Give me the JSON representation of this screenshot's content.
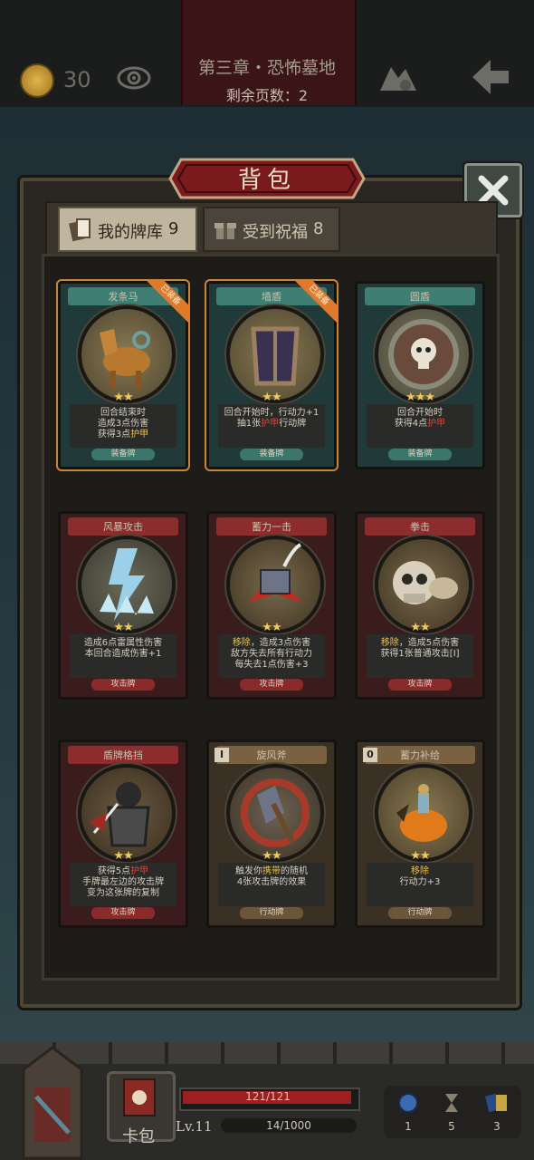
{
  "topbar": {
    "coins": "30",
    "chapter_title": "第三章・恐怖墓地",
    "pages_left": "剩余页数：2"
  },
  "panel": {
    "title": "背包",
    "tabs": [
      {
        "label": "我的牌库",
        "count": "9",
        "active": true
      },
      {
        "label": "受到祝福",
        "count": "8",
        "active": false
      }
    ]
  },
  "cards": [
    {
      "name": "发条马",
      "stars": "★★",
      "desc1": "回合结束时",
      "desc2": "造成3点伤害",
      "desc3_pre": "获得3点",
      "desc3_hl": "护甲",
      "type": "装备牌",
      "equipped": true,
      "badge": "已装备"
    },
    {
      "name": "墙盾",
      "stars": "★★",
      "desc1": "回合开始时，行动力+1",
      "desc2_pre": "抽1张",
      "desc2_hl": "护甲",
      "desc2_post": "行动牌",
      "type": "装备牌",
      "equipped": true,
      "badge": "已装备"
    },
    {
      "name": "圆盾",
      "stars": "★★★",
      "desc1": "回合开始时",
      "desc2_pre": "获得4点",
      "desc2_hl": "护甲",
      "type": "装备牌",
      "equipped": false
    },
    {
      "name": "风暴攻击",
      "stars": "★★",
      "desc1": "造成6点雷属性伤害",
      "desc2": "本回合造成伤害+1",
      "type": "攻击牌"
    },
    {
      "name": "蓄力一击",
      "stars": "★★",
      "desc1_hl": "移除",
      "desc1": "，造成3点伤害",
      "desc2": "敌方失去所有行动力",
      "desc3": "每失去1点伤害+3",
      "type": "攻击牌"
    },
    {
      "name": "拳击",
      "stars": "★★",
      "desc1_hl": "移除",
      "desc1": "，造成5点伤害",
      "desc2": "获得1张普通攻击[I]",
      "type": "攻击牌"
    },
    {
      "name": "盾牌格挡",
      "stars": "★★",
      "desc1_pre": "获得5点",
      "desc1_hl": "护甲",
      "desc2": "手牌最左边的攻击牌",
      "desc3": "变为这张牌的复制",
      "type": "攻击牌"
    },
    {
      "name": "旋风斧",
      "stars": "★★",
      "desc1_pre": "触发你",
      "desc1_hl": "携带",
      "desc1_post": "的随机",
      "desc2": "4张攻击牌的效果",
      "type": "行动牌",
      "corner": "I"
    },
    {
      "name": "蓄力补给",
      "stars": "★★",
      "desc1_hl": "移除",
      "desc2": "行动力+3",
      "type": "行动牌",
      "corner": "0"
    }
  ],
  "bottom": {
    "bag_label": "卡包",
    "hp": "121/121",
    "hp_fraction": 1.0,
    "level": "Lv.11",
    "xp": "14/1000",
    "xp_fraction": 0.014,
    "resources": [
      "1",
      "5",
      "3"
    ]
  }
}
